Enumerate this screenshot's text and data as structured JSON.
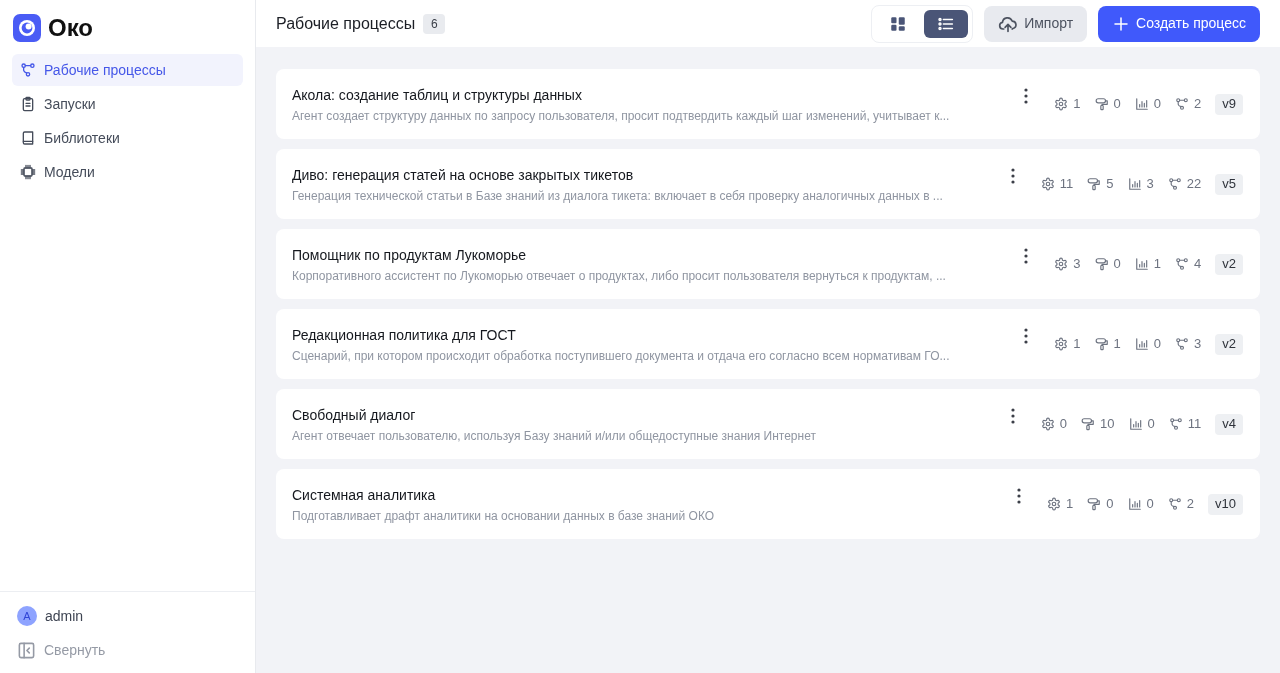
{
  "sidebar": {
    "logo": {
      "text": "Око"
    },
    "nav": [
      {
        "label": "Рабочие процессы",
        "selected": true
      },
      {
        "label": "Запуски",
        "selected": false
      },
      {
        "label": "Библиотеки",
        "selected": false
      },
      {
        "label": "Модели",
        "selected": false
      }
    ],
    "user": {
      "avatar_letter": "A",
      "name": "admin"
    },
    "collapse": {
      "label": "Свернуть"
    }
  },
  "header": {
    "title": "Рабочие процессы",
    "count": "6",
    "view_toggle": [
      {
        "selected": false
      },
      {
        "selected": true
      }
    ],
    "buttons": [
      {
        "kind": "secondary",
        "label": "Импорт"
      },
      {
        "kind": "primary",
        "label": "Создать процесс"
      }
    ]
  },
  "processes": [
    {
      "title": "Акола: создание таблиц и структуры данных",
      "description": "Агент создает структуру данных по запросу пользователя, просит подтвердить каждый шаг изменений, учитывает к...",
      "stats": [
        "1",
        "0",
        "0",
        "2"
      ],
      "version": "v9"
    },
    {
      "title": "Диво: генерация статей на основе закрытых тикетов",
      "description": "Генерация технической статьи в Базе знаний из диалога тикета: включает в себя проверку аналогичных данных в ...",
      "stats": [
        "11",
        "5",
        "3",
        "22"
      ],
      "version": "v5"
    },
    {
      "title": "Помощник по продуктам Лукоморье",
      "description": "Корпоративного ассистент по Лукоморью отвечает о продуктах, либо просит пользователя вернуться к продуктам, ...",
      "stats": [
        "3",
        "0",
        "1",
        "4"
      ],
      "version": "v2"
    },
    {
      "title": "Редакционная политика для ГОСТ",
      "description": "Сценарий, при котором происходит обработка поступившего документа и отдача его согласно всем нормативам ГО...",
      "stats": [
        "1",
        "1",
        "0",
        "3"
      ],
      "version": "v2"
    },
    {
      "title": "Свободный диалог",
      "description": "Агент отвечает пользователю, используя Базу знаний и/или общедоступные знания Интернет",
      "stats": [
        "0",
        "10",
        "0",
        "11"
      ],
      "version": "v4"
    },
    {
      "title": "Системная аналитика",
      "description": "Подготавливает драфт аналитики на основании данных в базе знаний ОКО",
      "stats": [
        "1",
        "0",
        "0",
        "2"
      ],
      "version": "v10"
    }
  ]
}
